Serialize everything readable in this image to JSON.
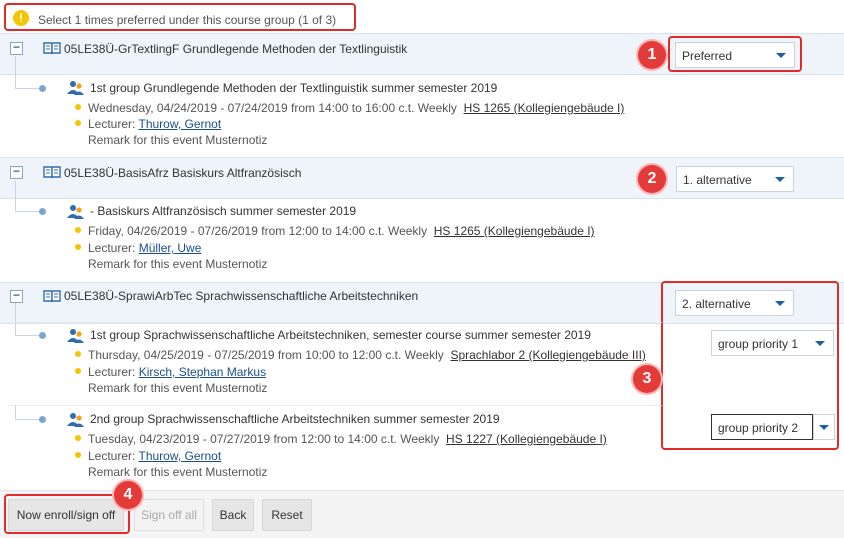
{
  "notice": {
    "text": "Select 1 times preferred under this course group (1 of 3)",
    "icon": "info-icon"
  },
  "courses": [
    {
      "title": "05LE38Ü-GrTextlingF Grundlegende Methoden der Textlinguistik",
      "select": "Preferred",
      "marker": "1",
      "groups": [
        {
          "title": "1st group Grundlegende Methoden der Textlinguistik summer semester 2019",
          "schedule": "Wednesday, 04/24/2019 - 07/24/2019 from 14:00 to 16:00 c.t. Weekly",
          "room": "HS 1265 (Kollegiengebäude I)",
          "lecturer_label": "Lecturer:",
          "lecturer": "Thurow, Gernot",
          "remark": "Remark for this event Musternotiz"
        }
      ]
    },
    {
      "title": "05LE38Ü-BasisAfrz Basiskurs Altfranzösisch",
      "select": "1. alternative",
      "marker": "2",
      "groups": [
        {
          "title": "- Basiskurs Altfranzösisch summer semester 2019",
          "schedule": "Friday, 04/26/2019 - 07/26/2019 from 12:00 to 14:00 c.t. Weekly",
          "room": "HS 1265 (Kollegiengebäude I)",
          "lecturer_label": "Lecturer:",
          "lecturer": "Müller, Uwe",
          "remark": "Remark for this event Musternotiz"
        }
      ]
    },
    {
      "title": "05LE38Ü-SprawiArbTec Sprachwissenschaftliche Arbeitstechniken",
      "select": "2. alternative",
      "marker": "3",
      "groups": [
        {
          "title": "1st group Sprachwissenschaftliche Arbeitstechniken, semester course summer semester 2019",
          "schedule": "Thursday, 04/25/2019 - 07/25/2019 from 10:00 to 12:00 c.t. Weekly",
          "room": "Sprachlabor 2 (Kollegiengebäude III)",
          "lecturer_label": "Lecturer:",
          "lecturer": "Kirsch, Stephan Markus",
          "remark": "Remark for this event Musternotiz",
          "priority": "group priority 1"
        },
        {
          "title": "2nd group Sprachwissenschaftliche Arbeitstechniken summer semester 2019",
          "schedule": "Tuesday, 04/23/2019 - 07/27/2019 from 12:00 to 14:00 c.t. Weekly",
          "room": "HS 1227 (Kollegiengebäude I)",
          "lecturer_label": "Lecturer:",
          "lecturer": "Thurow, Gernot",
          "remark": "Remark for this event Musternotiz",
          "priority": "group priority 2"
        }
      ]
    }
  ],
  "footer": {
    "enroll": "Now enroll/sign off",
    "signoff_all": "Sign off all",
    "back": "Back",
    "reset": "Reset",
    "marker": "4"
  },
  "colors": {
    "marker_red": "#e33a3a",
    "link_blue": "#1c4f8a",
    "dot_yellow": "#f6c400",
    "dot_blue": "#7ea6cc"
  }
}
